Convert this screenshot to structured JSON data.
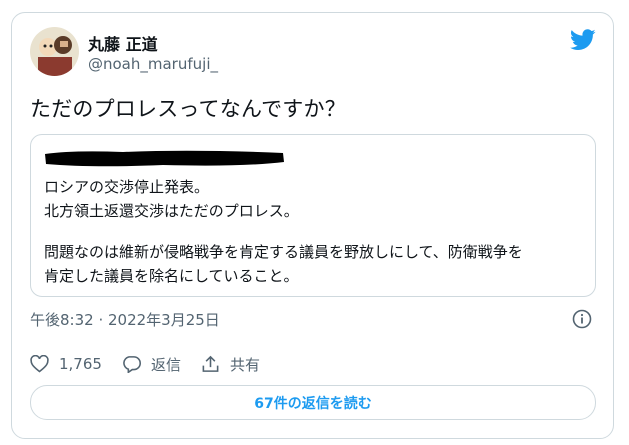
{
  "tweet": {
    "author_name": "丸藤 正道",
    "author_handle": "@noah_marufuji_",
    "text": "ただのプロレスってなんですか？",
    "quoted": {
      "lines": [
        "ロシアの交渉停止発表。",
        "北方領土返還交渉はただのプロレス。",
        "問題なのは維新が侵略戦争を肯定する議員を野放しにして、防衛戦争を",
        "肯定した議員を除名にしていること。"
      ]
    },
    "timestamp": "午後8:32 · 2022年3月25日",
    "likes": "1,765",
    "reply_label": "返信",
    "share_label": "共有",
    "read_replies_label": "67件の返信を読む"
  },
  "colors": {
    "accent": "#1d9bf0",
    "secondary_text": "#536471",
    "border": "#cfd9de"
  },
  "icons": [
    "twitter-bird-icon",
    "info-icon",
    "heart-icon",
    "reply-icon",
    "share-icon"
  ]
}
